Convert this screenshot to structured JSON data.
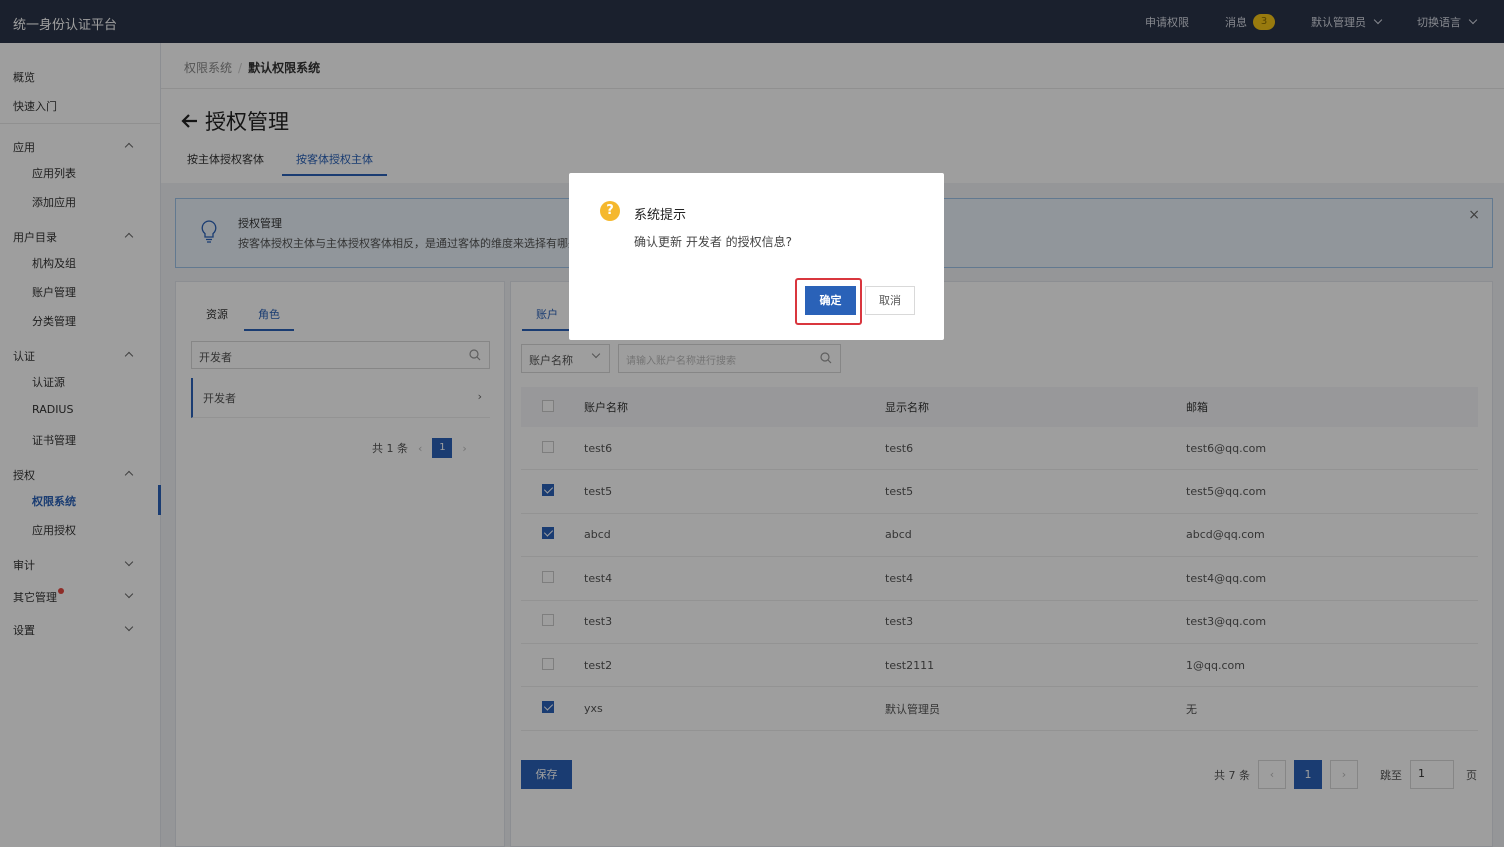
{
  "topbar": {
    "brand": "统一身份认证平台",
    "apply": "申请权限",
    "messages": "消息",
    "message_count": "3",
    "user": "默认管理员",
    "language": "切换语言"
  },
  "sidebar": {
    "overview": "概览",
    "quickstart": "快速入门",
    "app": "应用",
    "app_list": "应用列表",
    "app_add": "添加应用",
    "directory": "用户目录",
    "org": "机构及组",
    "accounts": "账户管理",
    "categories": "分类管理",
    "auth": "认证",
    "auth_source": "认证源",
    "radius": "RADIUS",
    "certs": "证书管理",
    "authorization": "授权",
    "perm_system": "权限系统",
    "app_auth": "应用授权",
    "audit": "审计",
    "other": "其它管理",
    "settings": "设置"
  },
  "breadcrumb": {
    "parent": "权限系统",
    "sep": "/",
    "current": "默认权限系统"
  },
  "page": {
    "title": "授权管理",
    "tab1": "按主体授权客体",
    "tab2": "按客体授权主体"
  },
  "tip": {
    "title": "授权管理",
    "text": "按客体授权主体与主体授权客体相反，是通过客体的维度来选择有哪些"
  },
  "left": {
    "tab_resource": "资源",
    "tab_role": "角色",
    "search_value": "开发者",
    "item": "开发者",
    "total": "共 1 条",
    "page": "1"
  },
  "right": {
    "tab": "账户",
    "select": "账户名称",
    "search_placeholder": "请输入账户名称进行搜索",
    "columns": {
      "name": "账户名称",
      "display": "显示名称",
      "email": "邮箱"
    },
    "rows": [
      {
        "name": "test6",
        "display": "test6",
        "email": "test6@qq.com",
        "checked": false
      },
      {
        "name": "test5",
        "display": "test5",
        "email": "test5@qq.com",
        "checked": true
      },
      {
        "name": "abcd",
        "display": "abcd",
        "email": "abcd@qq.com",
        "checked": true
      },
      {
        "name": "test4",
        "display": "test4",
        "email": "test4@qq.com",
        "checked": false
      },
      {
        "name": "test3",
        "display": "test3",
        "email": "test3@qq.com",
        "checked": false
      },
      {
        "name": "test2",
        "display": "test2111",
        "email": "1@qq.com",
        "checked": false
      },
      {
        "name": "yxs",
        "display": "默认管理员",
        "email": "无",
        "checked": true
      }
    ],
    "save": "保存",
    "total": "共 7 条",
    "page": "1",
    "jump": "跳至",
    "jump_value": "1",
    "page_unit": "页"
  },
  "modal": {
    "title": "系统提示",
    "text": "确认更新 开发者 的授权信息?",
    "ok": "确定",
    "cancel": "取消"
  },
  "colors": {
    "primary": "#2a62b8",
    "topbar": "#2b3549",
    "highlight": "#d9363e"
  }
}
